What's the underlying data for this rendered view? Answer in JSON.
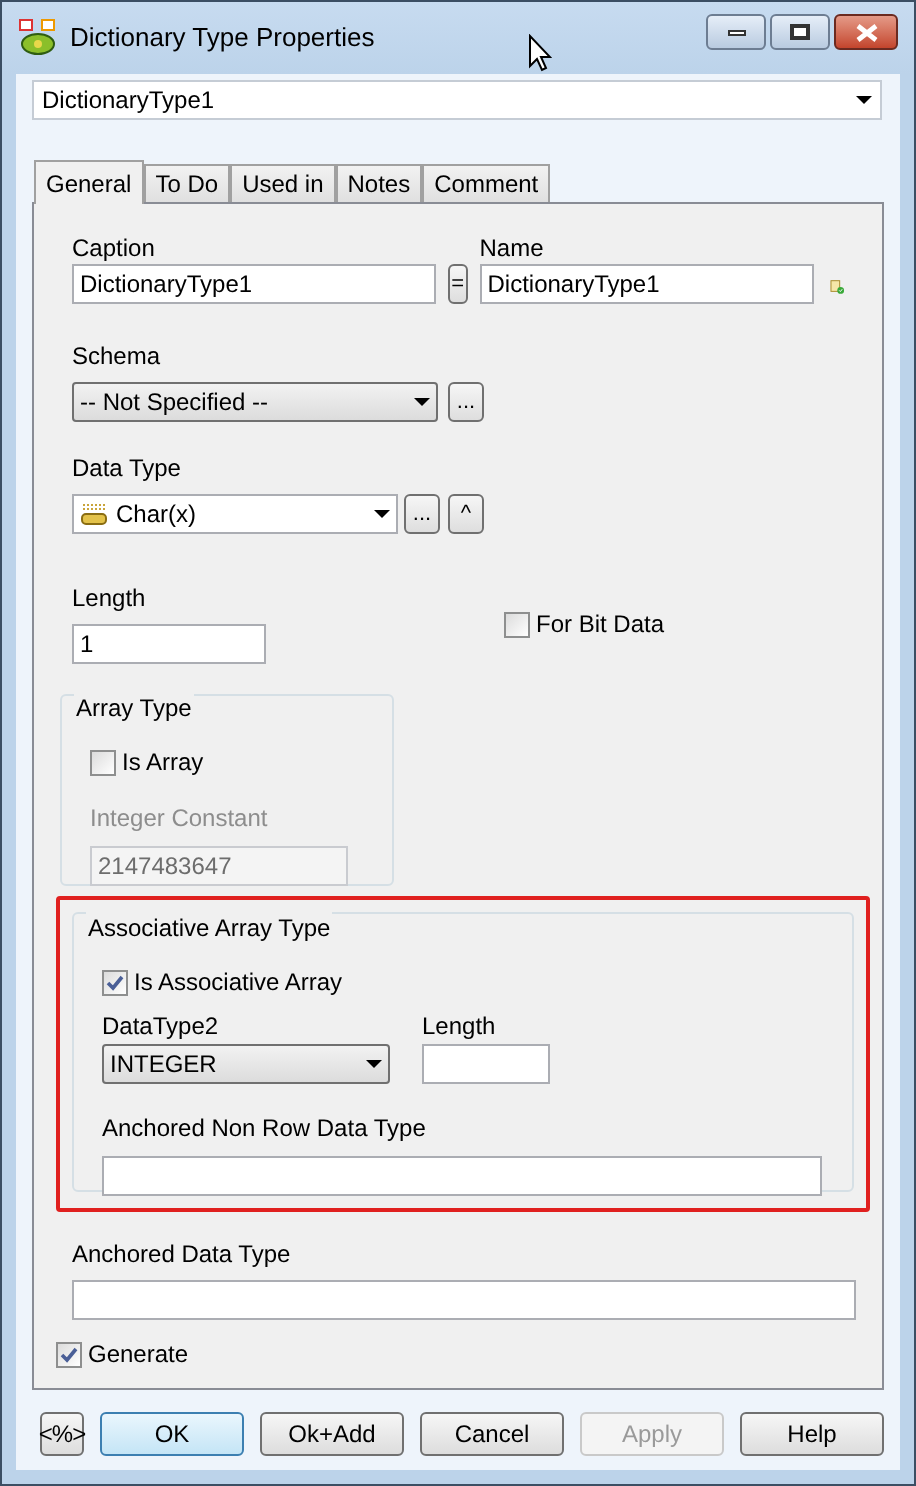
{
  "window": {
    "title": "Dictionary Type Properties"
  },
  "object_selector": {
    "value": "DictionaryType1"
  },
  "tabs": [
    {
      "label": "General",
      "selected": true
    },
    {
      "label": "To Do",
      "selected": false
    },
    {
      "label": "Used in",
      "selected": false
    },
    {
      "label": "Notes",
      "selected": false
    },
    {
      "label": "Comment",
      "selected": false
    }
  ],
  "caption": {
    "label": "Caption",
    "value": "DictionaryType1"
  },
  "equals_button": "=",
  "name": {
    "label": "Name",
    "value": "DictionaryType1"
  },
  "schema": {
    "label": "Schema",
    "value": "-- Not Specified --",
    "browse": "..."
  },
  "data_type": {
    "label": "Data Type",
    "value": "Char(x)",
    "browse": "...",
    "up": "^"
  },
  "length": {
    "label": "Length",
    "value": "1"
  },
  "for_bit_data": {
    "label": "For Bit Data",
    "checked": false
  },
  "array_type": {
    "title": "Array Type",
    "is_array": {
      "label": "Is Array",
      "checked": false
    },
    "integer_constant": {
      "label": "Integer Constant",
      "value": "2147483647",
      "disabled": true
    }
  },
  "associative_array_type": {
    "title": "Associative Array Type",
    "highlighted": true,
    "is_associative_array": {
      "label": "Is Associative Array",
      "checked": true
    },
    "datatype2": {
      "label": "DataType2",
      "value": "INTEGER"
    },
    "length": {
      "label": "Length"
    },
    "anchored_non_row": {
      "label": "Anchored Non Row Data Type"
    }
  },
  "anchored_data_type": {
    "label": "Anchored Data Type"
  },
  "generate": {
    "label": "Generate",
    "checked": true
  },
  "buttons": [
    {
      "label": "<%>",
      "kind": "small",
      "disabled": false,
      "default": false
    },
    {
      "label": "OK",
      "kind": "normal",
      "disabled": false,
      "default": true
    },
    {
      "label": "Ok+Add",
      "kind": "normal",
      "disabled": false,
      "default": false
    },
    {
      "label": "Cancel",
      "kind": "normal",
      "disabled": false,
      "default": false
    },
    {
      "label": "Apply",
      "kind": "normal",
      "disabled": true,
      "default": false
    },
    {
      "label": "Help",
      "kind": "normal",
      "disabled": false,
      "default": false
    }
  ]
}
